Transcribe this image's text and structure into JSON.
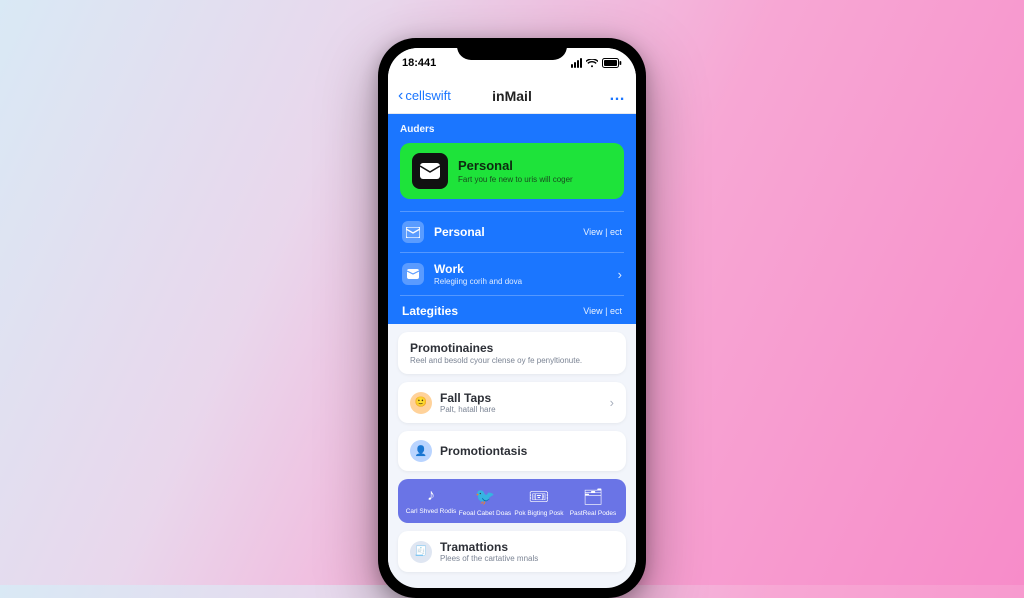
{
  "status": {
    "time": "18:441"
  },
  "nav": {
    "back": "cellswift",
    "title": "inMail",
    "more": "…"
  },
  "section_folders": "Auders",
  "hero": {
    "title": "Personal",
    "subtitle": "Fart you fe new to uris will coger"
  },
  "folders": {
    "personal": {
      "label": "Personal",
      "action": "View | ect"
    },
    "work": {
      "label": "Work",
      "subtitle": "Relegiing corih and dova"
    }
  },
  "categories": {
    "title": "Lategities",
    "action": "View | ect"
  },
  "items": {
    "promo": {
      "title": "Promotinaines",
      "subtitle": "Reel and besold cyour clense oy fe penyltionute."
    },
    "fall": {
      "title": "Fall Taps",
      "subtitle": "Palt, hatall hare"
    },
    "promo2": {
      "title": "Promotiontasis"
    },
    "trans": {
      "title": "Tramattions",
      "subtitle": "Plees of the cartative mnals"
    }
  },
  "quick": {
    "a": "Carl Shved\nRodis",
    "b": "Feoal Cabet\nDoas",
    "c": "Pok Bigting\nPosk",
    "d": "PastReal\nPodes"
  }
}
